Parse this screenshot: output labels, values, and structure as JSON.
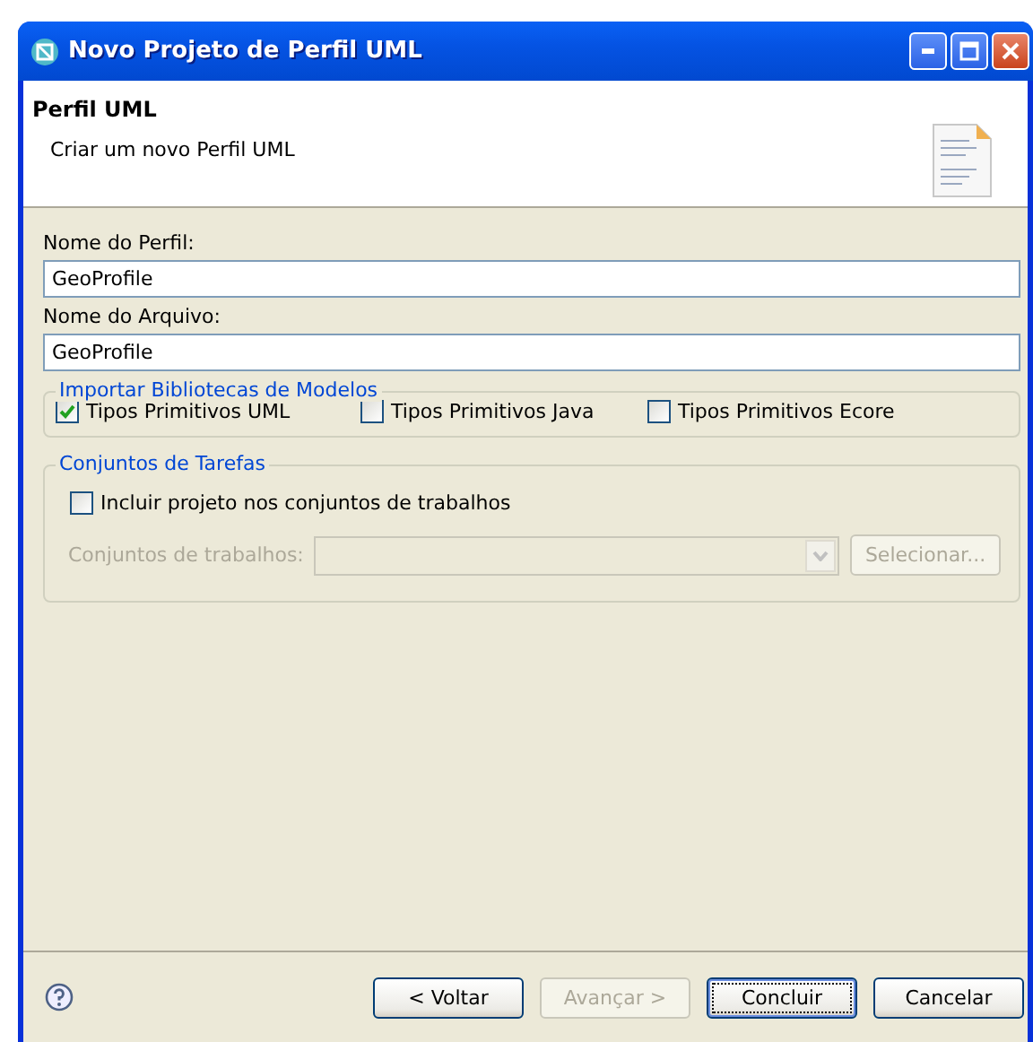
{
  "window": {
    "title": "Novo Projeto de Perfil UML"
  },
  "header": {
    "title": "Perfil UML",
    "description": "Criar um novo Perfil UML"
  },
  "fields": [
    {
      "label": "Nome do Perfil:",
      "value": "GeoProfile"
    },
    {
      "label": "Nome do Arquivo:",
      "value": "GeoProfile"
    }
  ],
  "import_libraries": {
    "title": "Importar Bibliotecas de Modelos",
    "options": [
      {
        "label": "Tipos Primitivos UML",
        "checked": true
      },
      {
        "label": "Tipos Primitivos Java",
        "checked": false
      },
      {
        "label": "Tipos Primitivos Ecore",
        "checked": false
      }
    ]
  },
  "working_sets": {
    "title": "Conjuntos de Tarefas",
    "include": {
      "label": "Incluir projeto nos conjuntos de trabalhos",
      "checked": false
    },
    "combo_label": "Conjuntos de trabalhos:",
    "disabled": true,
    "select_button": "Selecionar..."
  },
  "buttons": [
    {
      "label": "< Voltar",
      "disabled": false,
      "default": false
    },
    {
      "label": "Avançar >",
      "disabled": true,
      "default": false
    },
    {
      "label": "Concluir",
      "disabled": false,
      "default": true
    },
    {
      "label": "Cancelar",
      "disabled": false,
      "default": false
    }
  ]
}
